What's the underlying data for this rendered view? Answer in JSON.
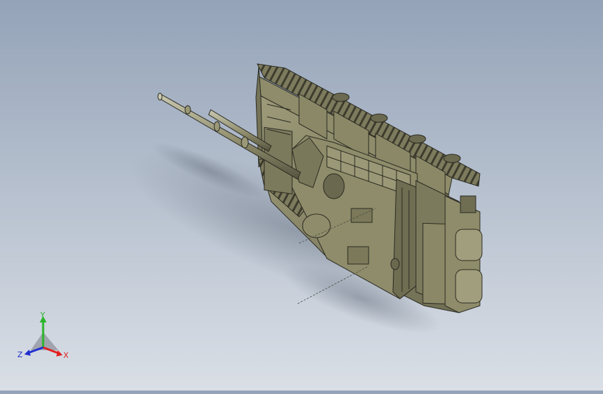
{
  "viewport": {
    "background_top": "#94a3b8",
    "background_bottom": "#dadfe6",
    "model_color": "#8c8a68",
    "model_shadow": "#5d5b45",
    "edge_color": "#2a2a22"
  },
  "triad": {
    "x_label": "X",
    "y_label": "Y",
    "z_label": "Z",
    "x_color": "#e02020",
    "y_color": "#2bb52b",
    "z_color": "#2030d0"
  }
}
